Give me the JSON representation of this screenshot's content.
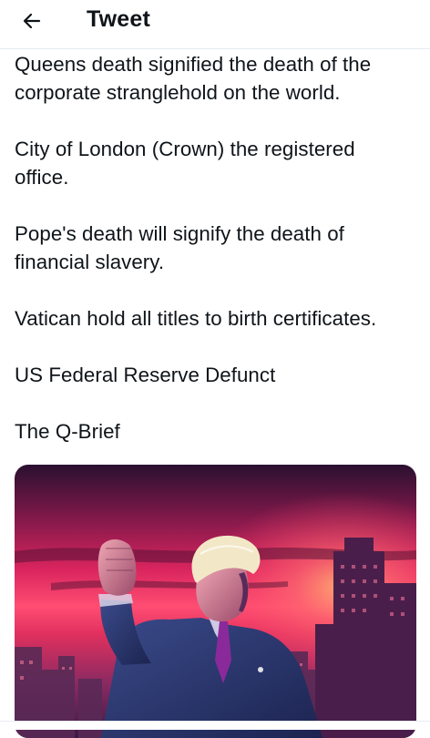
{
  "header": {
    "back_icon": "arrow-left-icon",
    "title": "Tweet"
  },
  "tweet": {
    "paragraphs": [
      {
        "line1": "Queens death signified the death of the",
        "line2": "corporate stranglehold on the world."
      },
      {
        "line1": "City of London (Crown) the registered",
        "line2": "office."
      },
      {
        "line1": "Pope's death will signify the death of",
        "line2": "financial slavery."
      },
      {
        "line1": "Vatican hold all titles to birth certificates."
      },
      {
        "line1": "US Federal Reserve Defunct"
      },
      {
        "line1": "The Q-Brief"
      }
    ],
    "media": {
      "kind": "image",
      "colors": {
        "sky_top": "#2a1030",
        "sky_mid": "#c4205e",
        "sky_glow": "#ff5a78",
        "horizon": "#ff9a6a",
        "city": "#5a2a52",
        "suit": "#2a3466",
        "tie": "#8a2a9a",
        "skin": "#d68a9a"
      }
    }
  }
}
